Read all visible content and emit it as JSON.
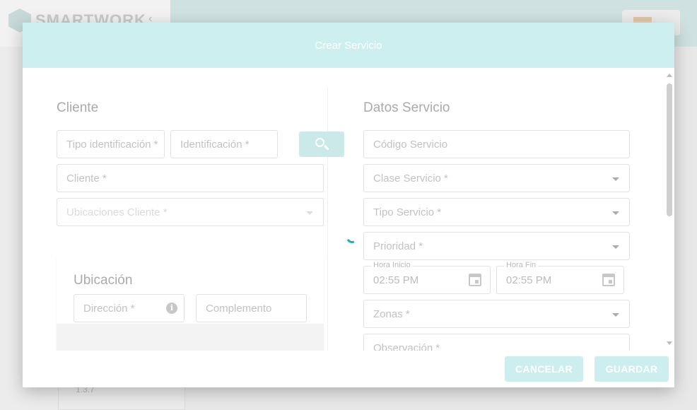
{
  "background": {
    "logo_text": "SMARTWORK",
    "version": "1.3.7"
  },
  "modal": {
    "title": "Crear Servicio"
  },
  "cliente": {
    "section_title": "Cliente",
    "tipo_identificacion_placeholder": "Tipo identificación *",
    "identificacion_placeholder": "Identificación *",
    "cliente_placeholder": "Cliente *",
    "ubicaciones_placeholder": "Ubicaciones Cliente *"
  },
  "ubicacion": {
    "section_title": "Ubicación",
    "direccion_placeholder": "Dirección *",
    "complemento_placeholder": "Complemento"
  },
  "datos_servicio": {
    "section_title": "Datos Servicio",
    "codigo_placeholder": "Código Servicio",
    "clase_placeholder": "Clase Servicio *",
    "tipo_placeholder": "Tipo Servicio *",
    "prioridad_placeholder": "Prioridad *",
    "hora_inicio_label": "Hora Inicio",
    "hora_inicio_value": "02:55 PM",
    "hora_fin_label": "Hora Fin",
    "hora_fin_value": "02:55 PM",
    "zonas_placeholder": "Zonas *",
    "observacion_placeholder": "Observación *"
  },
  "footer": {
    "cancel_label": "CANCELAR",
    "save_label": "GUARDAR"
  },
  "colors": {
    "header_bg": "#cdefef",
    "button_bg": "#cdeeee",
    "spinner": "#19b1b1"
  }
}
